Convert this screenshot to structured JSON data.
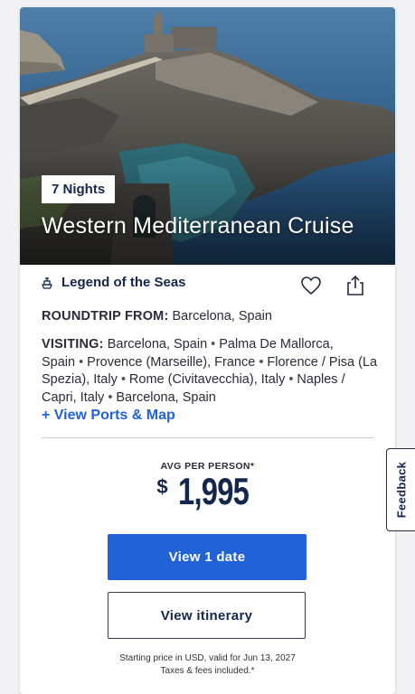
{
  "hero": {
    "nights_badge": "7 Nights",
    "title": "Western Mediterranean Cruise",
    "image_subject": "coastal church on rocky cliff above blue sea"
  },
  "ship": {
    "icon": "ship-icon",
    "name": "Legend of the Seas"
  },
  "actions": {
    "favorite_icon": "heart-icon",
    "share_icon": "share-icon"
  },
  "itinerary": {
    "roundtrip_label": "ROUNDTRIP FROM:",
    "roundtrip_value": "Barcelona, Spain",
    "visiting_label": "VISITING:",
    "ports": [
      "Barcelona, Spain",
      "Palma De Mallorca, Spain",
      "Provence (Marseille), France",
      "Florence / Pisa (La Spezia), Italy",
      "Rome (Civitavecchia), Italy",
      "Naples / Capri, Italy",
      "Barcelona, Spain"
    ],
    "view_ports_link": "+ View Ports & Map"
  },
  "pricing": {
    "avg_label": "AVG PER PERSON*",
    "currency_symbol": "$",
    "amount": "1,995",
    "footnote_line1": "Starting price in USD, valid for Jun 13, 2027",
    "footnote_line2": "Taxes & fees included.*"
  },
  "buttons": {
    "view_dates": "View 1 date",
    "view_itinerary": "View itinerary"
  },
  "feedback_tab": "Feedback",
  "colors": {
    "primary": "#2162d6",
    "navy": "#15264d",
    "link": "#2063d8"
  }
}
